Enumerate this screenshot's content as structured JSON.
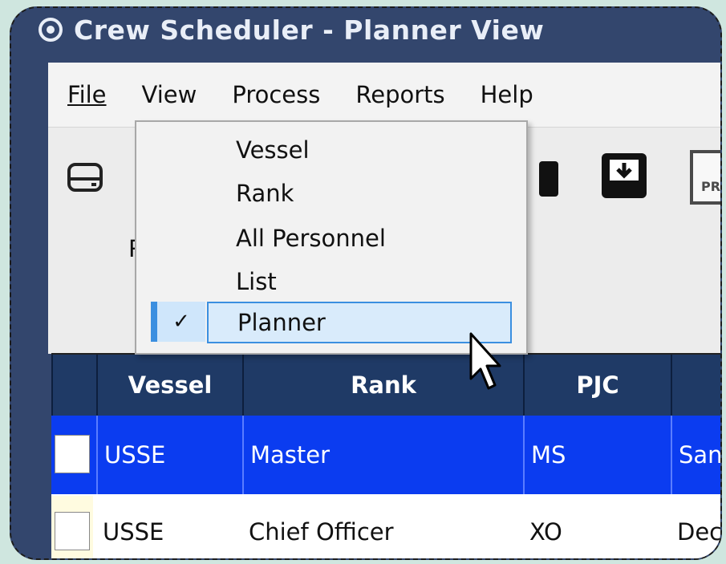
{
  "window": {
    "title": "Crew Scheduler - Planner View"
  },
  "menu": {
    "file": "File",
    "view": "View",
    "process": "Process",
    "reports": "Reports",
    "help": "Help"
  },
  "toolbar": {
    "partial_label": "R",
    "pr_icon_text": "PR",
    "icons": [
      "drive-icon",
      "pillar-icon",
      "download-icon",
      "pr-document-icon"
    ]
  },
  "view_menu": {
    "items": [
      {
        "label": "Vessel",
        "checked": false
      },
      {
        "label": "Rank",
        "checked": false
      },
      {
        "label": "All Personnel",
        "checked": false
      },
      {
        "label": "List",
        "checked": false
      },
      {
        "label": "Planner",
        "checked": true
      }
    ],
    "check_glyph": "✓"
  },
  "grid": {
    "columns": [
      "Vessel",
      "Rank",
      "PJC"
    ],
    "rows": [
      {
        "vessel": "USSE",
        "rank": "Master",
        "pjc": "MS",
        "extra": "San"
      },
      {
        "vessel": "USSE",
        "rank": "Chief Officer",
        "pjc": "XO",
        "extra": "Dec"
      }
    ]
  },
  "colors": {
    "titlebar": "#33466d",
    "header": "#1f3a66",
    "selected_row": "#0b3cf0",
    "menu_highlight": "#d9ebfb"
  }
}
